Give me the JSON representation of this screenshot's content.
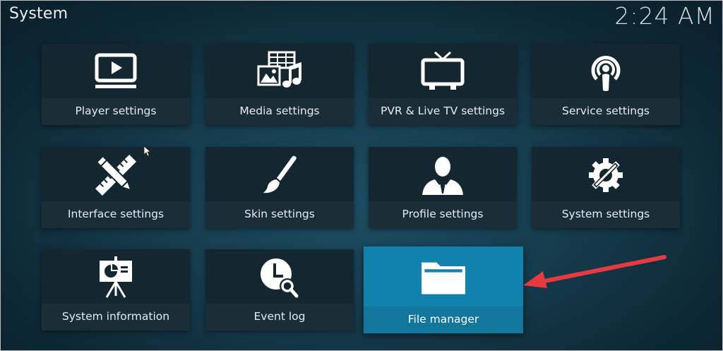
{
  "header": {
    "title": "System",
    "clock": "2:24 AM"
  },
  "tiles": [
    {
      "label": "Player settings",
      "icon": "tv-play-icon"
    },
    {
      "label": "Media settings",
      "icon": "media-icon"
    },
    {
      "label": "PVR & Live TV settings",
      "icon": "tv-antenna-icon"
    },
    {
      "label": "Service settings",
      "icon": "podcast-icon"
    },
    {
      "label": "Interface settings",
      "icon": "pencil-ruler-icon"
    },
    {
      "label": "Skin settings",
      "icon": "paintbrush-icon"
    },
    {
      "label": "Profile settings",
      "icon": "user-profile-icon"
    },
    {
      "label": "System settings",
      "icon": "gear-wrench-icon"
    },
    {
      "label": "System information",
      "icon": "presentation-icon"
    },
    {
      "label": "Event log",
      "icon": "clock-search-icon"
    },
    {
      "label": "File manager",
      "icon": "folder-icon"
    }
  ],
  "focused_tile": "File manager",
  "colors": {
    "focus": "#1182ad",
    "annotation_arrow": "#e53a3f"
  }
}
